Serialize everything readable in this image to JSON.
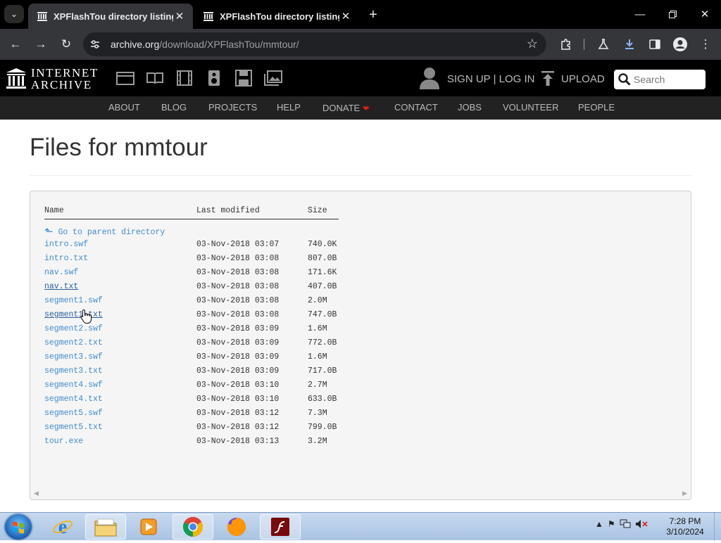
{
  "browser": {
    "tabs": [
      {
        "title": "XPFlashTou directory listing",
        "active": true
      },
      {
        "title": "XPFlashTou directory listing",
        "active": false
      }
    ],
    "url_host": "archive.org",
    "url_path": "/download/XPFlashTou/mmtour/"
  },
  "ia": {
    "logo_line1": "INTERNET",
    "logo_line2": "ARCHIVE",
    "signup_label": "SIGN UP | LOG IN",
    "upload_label": "UPLOAD",
    "search_placeholder": "Search",
    "nav": [
      "ABOUT",
      "BLOG",
      "PROJECTS",
      "HELP",
      "DONATE",
      "CONTACT",
      "JOBS",
      "VOLUNTEER",
      "PEOPLE"
    ]
  },
  "page": {
    "title": "Files for mmtour",
    "col_name": "Name",
    "col_modified": "Last modified",
    "col_size": "Size",
    "parent_link": "Go to parent directory",
    "files": [
      {
        "name": "intro.swf",
        "modified": "03-Nov-2018 03:07",
        "size": "740.0K"
      },
      {
        "name": "intro.txt",
        "modified": "03-Nov-2018 03:08",
        "size": "807.0B"
      },
      {
        "name": "nav.swf",
        "modified": "03-Nov-2018 03:08",
        "size": "171.6K"
      },
      {
        "name": "nav.txt",
        "modified": "03-Nov-2018 03:08",
        "size": "407.0B"
      },
      {
        "name": "segment1.swf",
        "modified": "03-Nov-2018 03:08",
        "size": "2.0M"
      },
      {
        "name": "segment1.txt",
        "modified": "03-Nov-2018 03:08",
        "size": "747.0B"
      },
      {
        "name": "segment2.swf",
        "modified": "03-Nov-2018 03:09",
        "size": "1.6M"
      },
      {
        "name": "segment2.txt",
        "modified": "03-Nov-2018 03:09",
        "size": "772.0B"
      },
      {
        "name": "segment3.swf",
        "modified": "03-Nov-2018 03:09",
        "size": "1.6M"
      },
      {
        "name": "segment3.txt",
        "modified": "03-Nov-2018 03:09",
        "size": "717.0B"
      },
      {
        "name": "segment4.swf",
        "modified": "03-Nov-2018 03:10",
        "size": "2.7M"
      },
      {
        "name": "segment4.txt",
        "modified": "03-Nov-2018 03:10",
        "size": "633.0B"
      },
      {
        "name": "segment5.swf",
        "modified": "03-Nov-2018 03:12",
        "size": "7.3M"
      },
      {
        "name": "segment5.txt",
        "modified": "03-Nov-2018 03:12",
        "size": "799.0B"
      },
      {
        "name": "tour.exe",
        "modified": "03-Nov-2018 03:13",
        "size": "3.2M"
      }
    ]
  },
  "taskbar": {
    "time": "7:28 PM",
    "date": "3/10/2024",
    "apps": [
      "internet-explorer",
      "file-explorer",
      "media-player",
      "chrome",
      "firefox",
      "flash-player"
    ]
  },
  "colors": {
    "link": "#428bca",
    "ia_bar": "#000000",
    "ia_nav": "#222222",
    "donate_heart": "#e21b1b"
  }
}
